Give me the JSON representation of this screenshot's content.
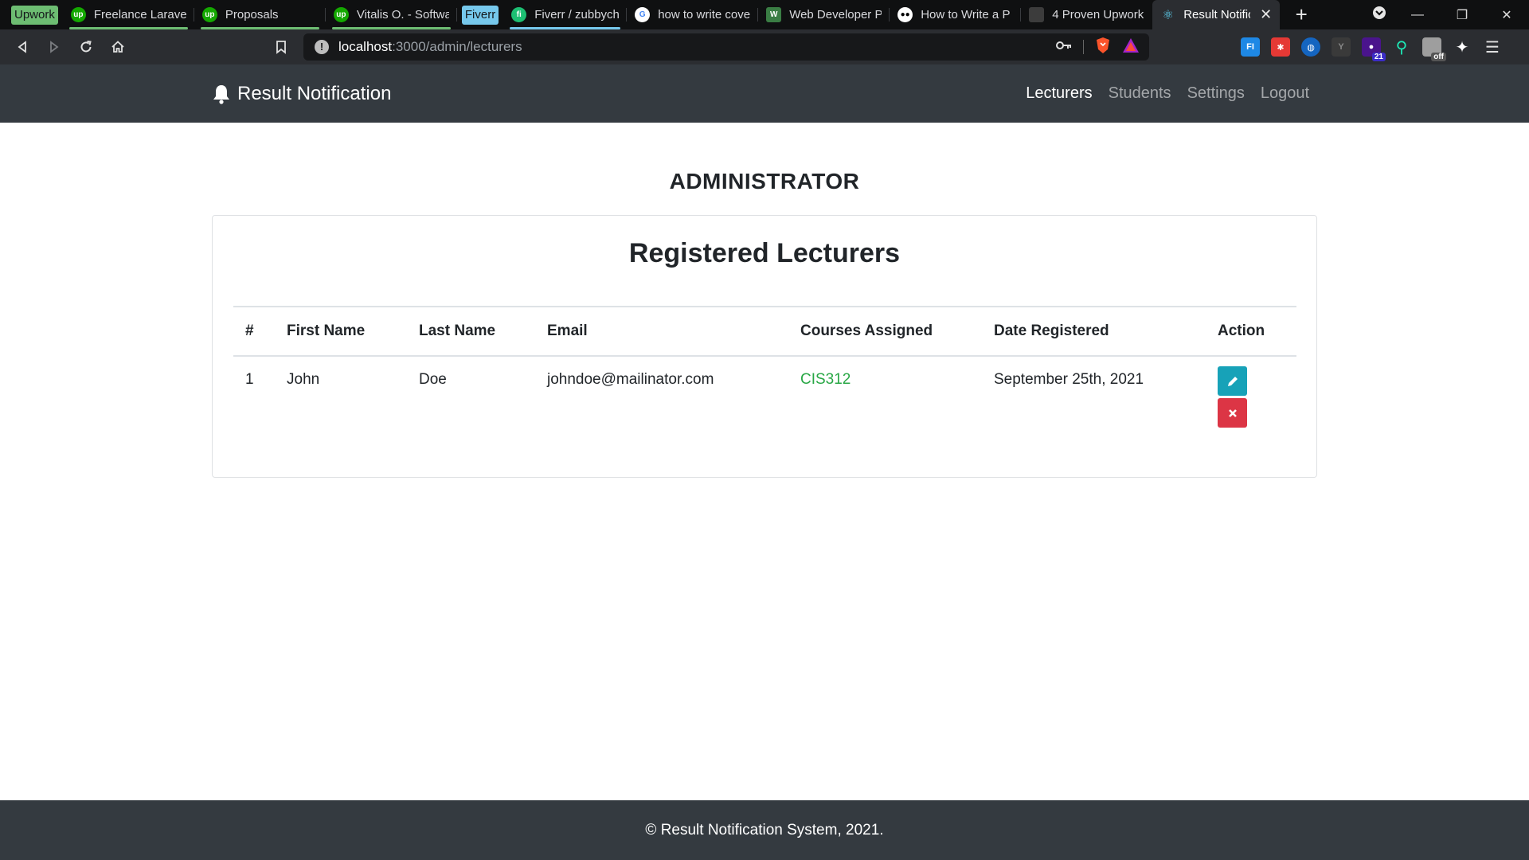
{
  "browser": {
    "tab_groups": [
      {
        "label": "Upwork",
        "color": "#6dbd72"
      },
      {
        "label": "Fiverr",
        "color": "#76c8ec"
      }
    ],
    "tabs": [
      {
        "title": "Freelance Laravel",
        "icon": "upwork-icon",
        "color": "#14a800"
      },
      {
        "title": "Proposals",
        "icon": "upwork-icon",
        "color": "#14a800"
      },
      {
        "title": "Vitalis O. - Softwa",
        "icon": "upwork-icon",
        "color": "#14a800"
      },
      {
        "title": "Fiverr / zubbychar",
        "icon": "fiverr-icon",
        "color": "#1dbf73"
      },
      {
        "title": "how to write cove",
        "icon": "google-icon",
        "color": "#ffffff"
      },
      {
        "title": "Web Developer P",
        "icon": "page-icon",
        "color": "#3a7d44"
      },
      {
        "title": "How to Write a P",
        "icon": "medium-icon",
        "color": "#ffffff"
      },
      {
        "title": "4 Proven Upwork",
        "icon": "page-icon",
        "color": "#555555"
      },
      {
        "title": "Result Notific",
        "icon": "react-icon",
        "color": "#61dafb"
      }
    ],
    "url_host": "localhost",
    "url_path": ":3000/admin/lecturers",
    "extension_badge": "21",
    "extension_off_badge": "off"
  },
  "navbar": {
    "brand": "Result Notification",
    "links": [
      {
        "label": "Lecturers",
        "active": true
      },
      {
        "label": "Students",
        "active": false
      },
      {
        "label": "Settings",
        "active": false
      },
      {
        "label": "Logout",
        "active": false
      }
    ]
  },
  "main": {
    "heading": "ADMINISTRATOR",
    "card_title": "Registered Lecturers",
    "table": {
      "columns": [
        "#",
        "First Name",
        "Last Name",
        "Email",
        "Courses Assigned",
        "Date Registered",
        "Action"
      ],
      "rows": [
        {
          "num": "1",
          "first_name": "John",
          "last_name": "Doe",
          "email": "johndoe@mailinator.com",
          "courses": "CIS312",
          "date_registered": "September 25th, 2021"
        }
      ]
    }
  },
  "footer": {
    "text": "© Result Notification System, 2021."
  },
  "colors": {
    "navbar_bg": "#343a40",
    "edit_button": "#17a2b8",
    "delete_button": "#dc3545",
    "course_link": "#28a745"
  }
}
